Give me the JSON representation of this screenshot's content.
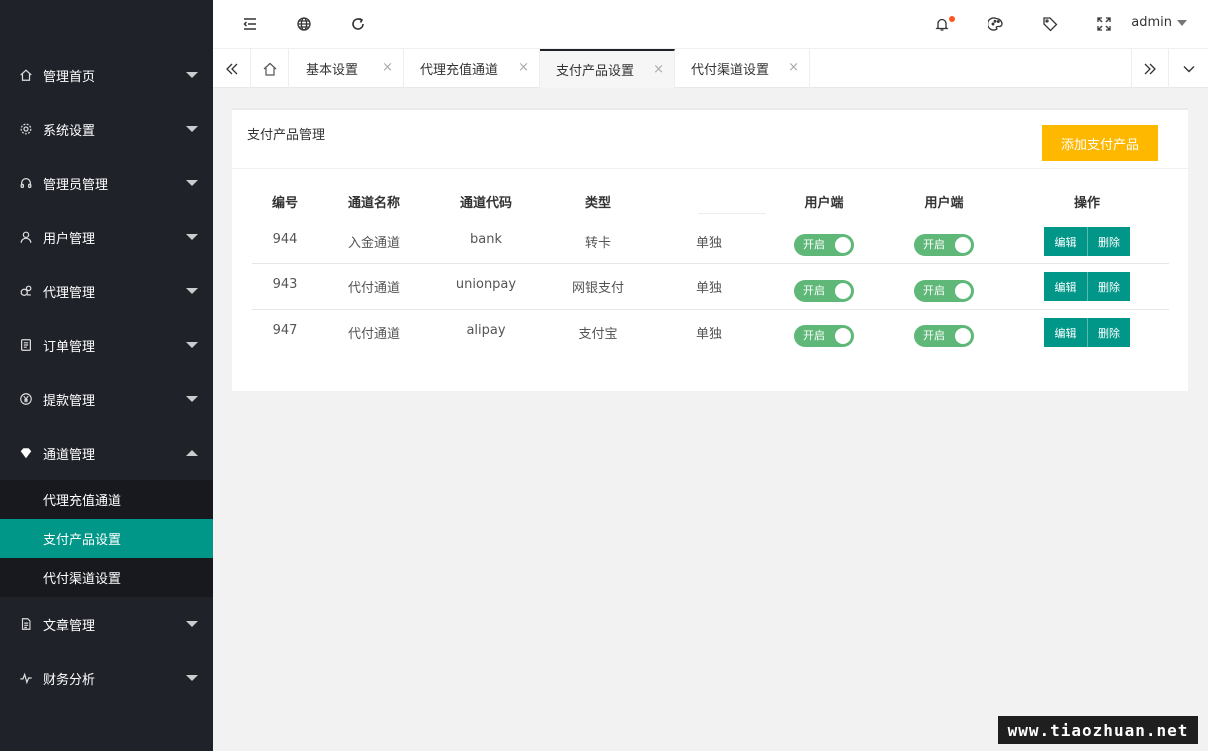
{
  "header": {
    "user_name": "admin",
    "colors": {
      "notification_dot": "#ff5722"
    }
  },
  "sidebar": {
    "items": [
      {
        "label": "管理首页",
        "icon": "home-icon"
      },
      {
        "label": "系统设置",
        "icon": "gear-icon"
      },
      {
        "label": "管理员管理",
        "icon": "headset-icon"
      },
      {
        "label": "用户管理",
        "icon": "user-icon"
      },
      {
        "label": "代理管理",
        "icon": "users-icon"
      },
      {
        "label": "订单管理",
        "icon": "list-icon"
      },
      {
        "label": "提款管理",
        "icon": "yen-icon"
      },
      {
        "label": "通道管理",
        "icon": "diamond-icon",
        "expanded": true,
        "children": [
          "代理充值通道",
          "支付产品设置",
          "代付渠道设置"
        ],
        "active_child": "支付产品设置"
      },
      {
        "label": "文章管理",
        "icon": "document-icon"
      },
      {
        "label": "财务分析",
        "icon": "chart-line-icon"
      }
    ],
    "colors": {
      "background": "#20222a",
      "submenu_background": "#17191e",
      "active": "#009688"
    }
  },
  "tabs": {
    "items": [
      {
        "label": "基本设置",
        "close": "×"
      },
      {
        "label": "代理充值通道",
        "close": "×"
      },
      {
        "label": "支付产品设置",
        "close": "×",
        "active": true
      },
      {
        "label": "代付渠道设置",
        "close": "×"
      }
    ]
  },
  "card": {
    "title": "支付产品管理",
    "add_button": "添加支付产品",
    "colors": {
      "add_button": "#ffb800",
      "switch_on": "#5fb878",
      "action_button": "#009688"
    }
  },
  "table": {
    "headers": [
      "编号",
      "通道名称",
      "通道代码",
      "类型",
      "",
      "用户端",
      "用户端",
      "操作"
    ],
    "rows": [
      {
        "id": "944",
        "name": "入金通道",
        "code": "bank",
        "type": "转卡",
        "mode": "单独",
        "switch1": "开启",
        "switch2": "开启",
        "edit": "编辑",
        "delete": "删除"
      },
      {
        "id": "943",
        "name": "代付通道",
        "code": "unionpay",
        "type": "网银支付",
        "mode": "单独",
        "switch1": "开启",
        "switch2": "开启",
        "edit": "编辑",
        "delete": "删除"
      },
      {
        "id": "947",
        "name": "代付通道",
        "code": "alipay",
        "type": "支付宝",
        "mode": "单独",
        "switch1": "开启",
        "switch2": "开启",
        "edit": "编辑",
        "delete": "删除"
      }
    ]
  },
  "watermark": "www.tiaozhuan.net"
}
